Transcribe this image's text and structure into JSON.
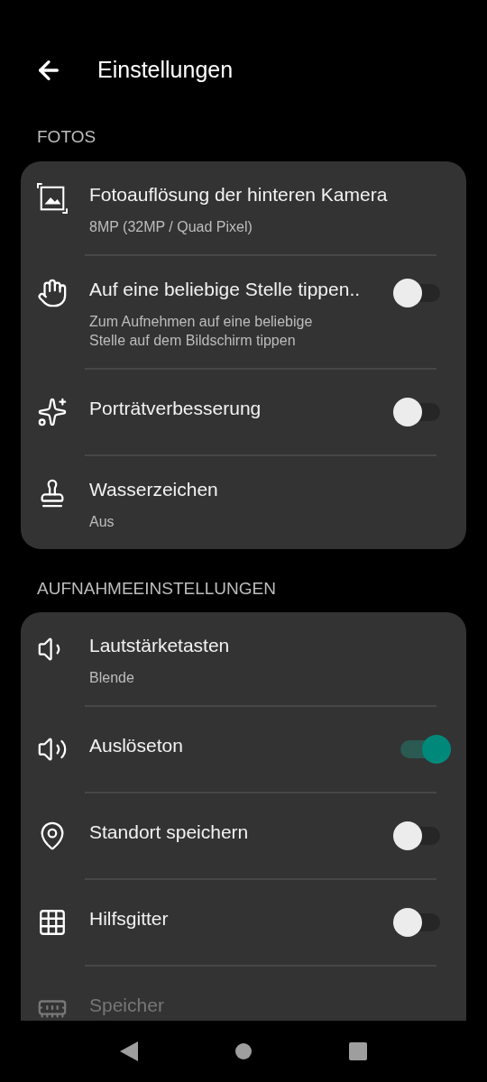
{
  "app_bar": {
    "title": "Einstellungen"
  },
  "sections": [
    {
      "title": "FOTOS",
      "items": [
        {
          "kind": "link",
          "title": "Fotoauflösung der hinteren Kamera",
          "subtitle": "8MP (32MP / Quad Pixel)",
          "disabled": false
        },
        {
          "kind": "toggle",
          "title": "Auf eine beliebige Stelle tippen..",
          "subtitle": "Zum Aufnehmen auf eine beliebige Stelle auf dem Bildschirm tippen",
          "on": false,
          "disabled": false
        },
        {
          "kind": "toggle",
          "title": "Porträtverbesserung",
          "on": false,
          "disabled": false
        },
        {
          "kind": "link",
          "title": "Wasserzeichen",
          "subtitle": "Aus",
          "disabled": false
        }
      ]
    },
    {
      "title": "AUFNAHMEEINSTELLUNGEN",
      "items": [
        {
          "kind": "link",
          "title": "Lautstärketasten",
          "subtitle": "Blende",
          "disabled": false
        },
        {
          "kind": "toggle",
          "title": "Auslöseton",
          "on": true,
          "disabled": false
        },
        {
          "kind": "toggle",
          "title": "Standort speichern",
          "on": false,
          "disabled": false
        },
        {
          "kind": "toggle",
          "title": "Hilfsgitter",
          "on": false,
          "disabled": false
        },
        {
          "kind": "link",
          "title": "Speicher",
          "disabled": true
        }
      ]
    }
  ]
}
